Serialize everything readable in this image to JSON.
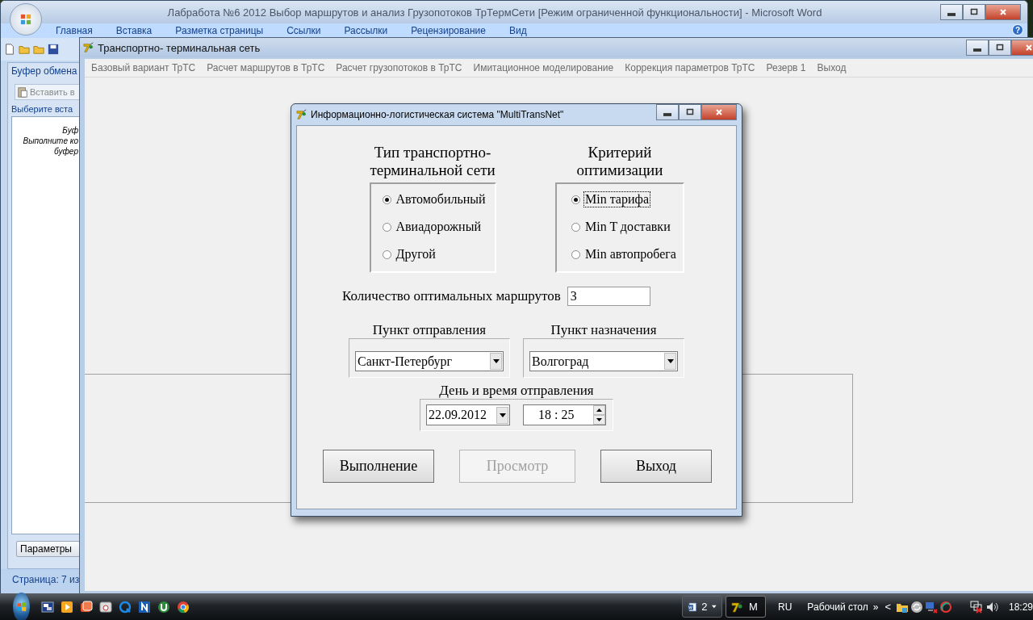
{
  "word_window": {
    "title": "Лабработа №6  2012 Выбор маршрутов и анализ Грузопотоков ТрТермСети [Режим ограниченной функциональности] - Microsoft Word",
    "ribbon_tabs": [
      "Главная",
      "Вставка",
      "Разметка страницы",
      "Ссылки",
      "Рассылки",
      "Рецензирование",
      "Вид"
    ],
    "help_button": "?",
    "clipboard_pane": {
      "title": "Буфер обмена",
      "paste_all_button": "Вставить в",
      "prompt": "Выберите вста",
      "message_lines": [
        "Буф",
        "Выполните ко",
        "буфер"
      ],
      "options_button": "Параметры"
    },
    "status_bar": "Страница: 7 из"
  },
  "app_window": {
    "title": "Транспортно- терминальная сеть",
    "menu": [
      "Базовый вариант ТрТС",
      "Расчет маршрутов в ТрТС",
      "Расчет грузопотоков в ТрТС",
      "Имитационное моделирование",
      "Коррекция параметров ТрТС",
      "Резерв 1",
      "Выход"
    ]
  },
  "dialog": {
    "title": "Информационно-логистическая система \"MultiTransNet\"",
    "network_type": {
      "heading": "Тип транспортно-терминальной сети",
      "options": [
        {
          "label": "Автомобильный",
          "selected": true,
          "focused": false
        },
        {
          "label": "Авиадорожный",
          "selected": false,
          "focused": false
        },
        {
          "label": "Другой",
          "selected": false,
          "focused": false
        }
      ]
    },
    "criterion": {
      "heading": "Критерий оптимизации",
      "options": [
        {
          "label": "Min тарифа",
          "selected": true,
          "focused": true
        },
        {
          "label": "Min T доставки",
          "selected": false,
          "focused": false
        },
        {
          "label": "Min автопробега",
          "selected": false,
          "focused": false
        }
      ]
    },
    "route_count": {
      "label": "Количество оптимальных маршрутов",
      "value": "3"
    },
    "origin": {
      "label": "Пункт отправления",
      "value": "Санкт-Петербург"
    },
    "destination": {
      "label": "Пункт назначения",
      "value": "Волгоград"
    },
    "departure": {
      "label": "День и время отправления",
      "date": "22.09.2012",
      "time": "18 : 25"
    },
    "buttons": [
      {
        "label": "Выполнение",
        "disabled": false
      },
      {
        "label": "Просмотр",
        "disabled": true
      },
      {
        "label": "Выход",
        "disabled": false
      }
    ]
  },
  "taskbar": {
    "tasks": [
      {
        "kind": "group",
        "label": "2",
        "selected": false
      },
      {
        "kind": "window",
        "label": "M",
        "selected": true
      }
    ],
    "language": "RU",
    "desktop_toolbar": "Рабочий стол",
    "toolbar_chevron": "»",
    "tray_expand": "<",
    "clock": "18:29"
  }
}
